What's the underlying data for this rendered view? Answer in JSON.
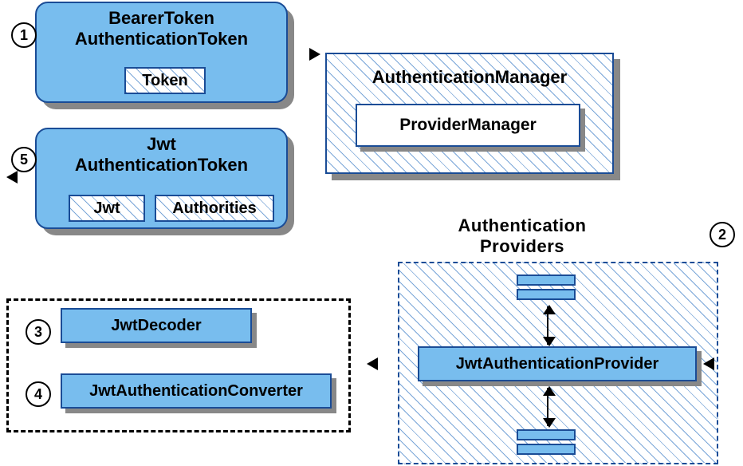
{
  "boxes": {
    "bearer": {
      "line1": "BearerToken",
      "line2": "AuthenticationToken",
      "inner": "Token"
    },
    "jwtAuth": {
      "line1": "Jwt",
      "line2": "AuthenticationToken",
      "innerLeft": "Jwt",
      "innerRight": "Authorities"
    },
    "manager": {
      "title": "AuthenticationManager",
      "inner": "ProviderManager"
    },
    "decoder": {
      "title": "JwtDecoder"
    },
    "converter": {
      "title": "JwtAuthenticationConverter"
    },
    "provider": {
      "title": "JwtAuthenticationProvider"
    }
  },
  "providersTitle": {
    "line1": "Authentication",
    "line2": "Providers"
  },
  "numbers": {
    "n1": "1",
    "n2": "2",
    "n3": "3",
    "n4": "4",
    "n5": "5"
  }
}
